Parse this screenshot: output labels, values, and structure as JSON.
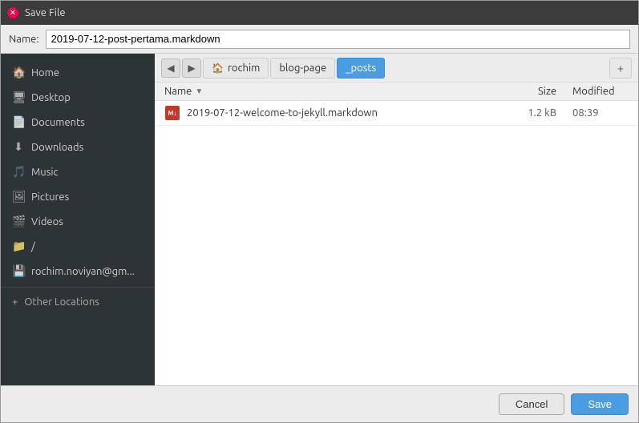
{
  "titlebar": {
    "close_symbol": "✕",
    "title": "Save File"
  },
  "name_row": {
    "label": "Name:",
    "value": "2019-07-12-post-pertama.markdown"
  },
  "sidebar": {
    "items": [
      {
        "id": "home",
        "label": "Home",
        "icon": "🏠"
      },
      {
        "id": "desktop",
        "label": "Desktop",
        "icon": "🖥"
      },
      {
        "id": "documents",
        "label": "Documents",
        "icon": "📄"
      },
      {
        "id": "downloads",
        "label": "Downloads",
        "icon": "⬇"
      },
      {
        "id": "music",
        "label": "Music",
        "icon": "🎵"
      },
      {
        "id": "pictures",
        "label": "Pictures",
        "icon": "🖼"
      },
      {
        "id": "videos",
        "label": "Videos",
        "icon": "🎬"
      },
      {
        "id": "root",
        "label": "/",
        "icon": "📁"
      },
      {
        "id": "account",
        "label": "rochim.noviyan@gm...",
        "icon": "💾"
      }
    ],
    "other_locations_label": "Other Locations",
    "other_locations_icon": "+"
  },
  "breadcrumb": {
    "back_arrow": "◀",
    "forward_arrow": "▶",
    "items": [
      {
        "id": "rochim",
        "label": "rochim",
        "icon": "🏠",
        "active": false
      },
      {
        "id": "blog-page",
        "label": "blog-page",
        "icon": null,
        "active": false
      },
      {
        "id": "_posts",
        "label": "_posts",
        "icon": null,
        "active": true
      }
    ],
    "new_folder_icon": "+"
  },
  "file_list": {
    "headers": {
      "name": "Name",
      "sort_arrow": "▼",
      "size": "Size",
      "modified": "Modified"
    },
    "files": [
      {
        "name": "2019-07-12-welcome-to-jekyll.markdown",
        "size": "1.2 kB",
        "modified": "08:39",
        "icon_type": "markdown"
      }
    ]
  },
  "buttons": {
    "cancel": "Cancel",
    "save": "Save"
  }
}
